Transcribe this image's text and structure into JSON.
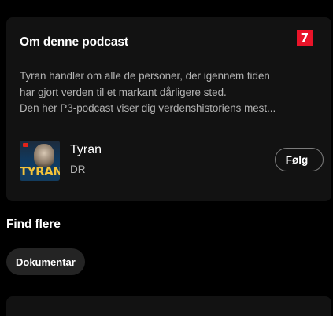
{
  "about": {
    "title": "Om denne podcast",
    "description_lines": [
      "Tyran handler om alle de personer, der igennem tiden",
      "har gjort verden til et markant dårligere sted.",
      "Den her P3-podcast viser dig verdenshistoriens mest..."
    ]
  },
  "show": {
    "name": "Tyran",
    "publisher": "DR",
    "cover_text": "TYRAN",
    "follow_label": "Følg",
    "annotation_badge": "7"
  },
  "find_more": {
    "heading": "Find flere",
    "chips": [
      "Dokumentar"
    ]
  },
  "colors": {
    "background": "#000000",
    "card": "#121212",
    "secondary_text": "#b3b3b3",
    "chip": "#242424",
    "badge": "#e91429"
  }
}
